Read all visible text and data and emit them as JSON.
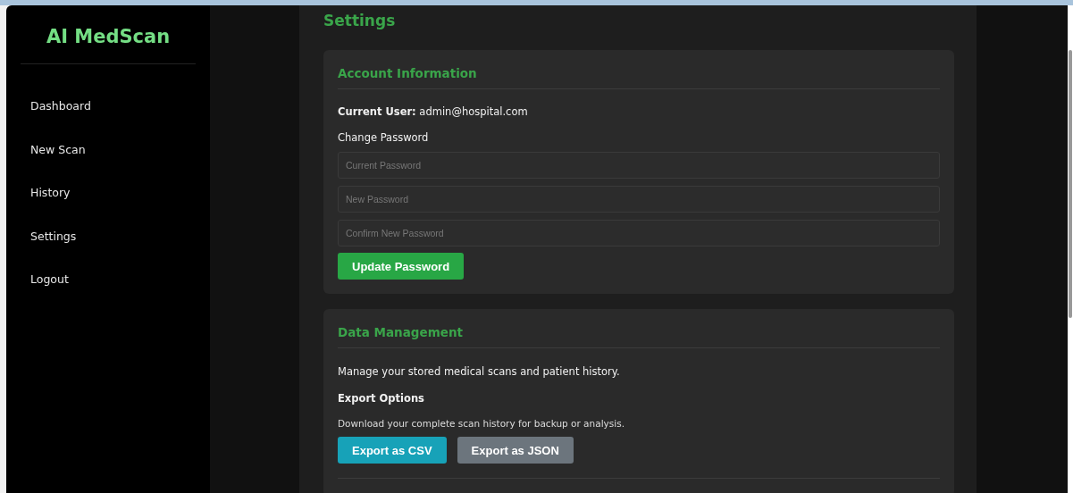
{
  "sidebar": {
    "logo": "AI MedScan",
    "items": [
      {
        "label": "Dashboard",
        "selected": false
      },
      {
        "label": "New Scan",
        "selected": false
      },
      {
        "label": "History",
        "selected": false
      },
      {
        "label": "Settings",
        "selected": false
      },
      {
        "label": "Logout",
        "selected": false
      }
    ]
  },
  "page_title": "Settings",
  "account": {
    "title": "Account Information",
    "current_user": "**Current User:** admin@hospital.com",
    "change_password_label": "Change Password",
    "fields": [
      {
        "placeholder": "Current Password"
      },
      {
        "placeholder": "New Password"
      },
      {
        "placeholder": "Confirm New Password"
      }
    ],
    "button": "Update Password"
  },
  "data_management": {
    "title": "Data Management",
    "description": "Manage your stored medical scans and patient history.",
    "export_title": "Export Options",
    "export_description": "Download your complete scan history for backup or analysis.",
    "buttons": [
      {
        "label": "Export as CSV",
        "kind": "primary"
      },
      {
        "label": "Export as JSON",
        "kind": "secondary"
      }
    ]
  }
}
